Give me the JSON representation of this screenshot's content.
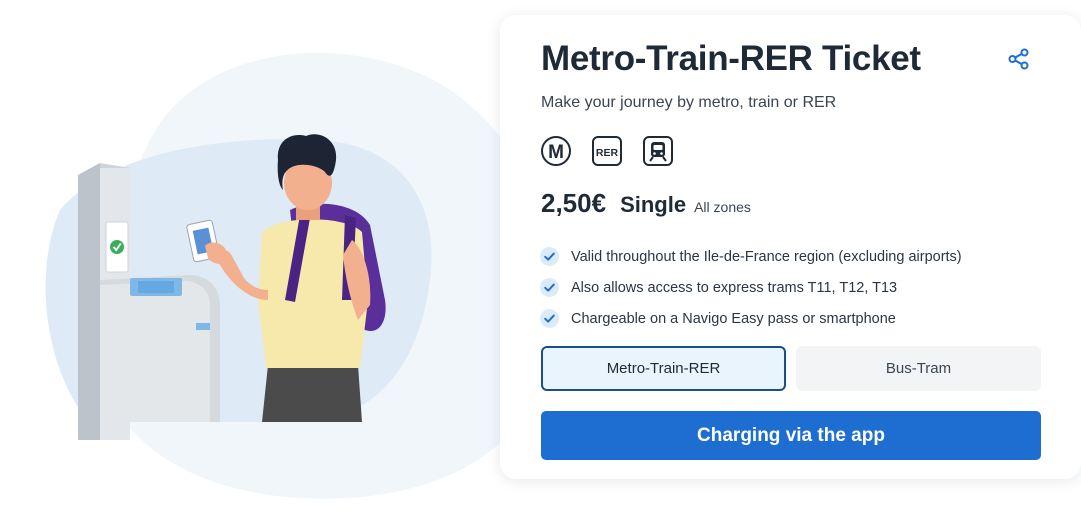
{
  "ticket": {
    "title": "Metro-Train-RER Ticket",
    "subtitle": "Make your journey by metro, train or RER",
    "price": "2,50€",
    "type": "Single",
    "zones": "All zones"
  },
  "transport_modes": [
    {
      "icon": "metro-icon",
      "label": "M"
    },
    {
      "icon": "rer-icon",
      "label": "RER"
    },
    {
      "icon": "train-icon",
      "label": ""
    }
  ],
  "features": [
    "Valid throughout the Ile-de-France region (excluding airports)",
    "Also allows access to express trams T11, T12, T13",
    "Chargeable on a Navigo Easy pass or smartphone"
  ],
  "tabs": [
    {
      "label": "Metro-Train-RER",
      "active": true
    },
    {
      "label": "Bus-Tram",
      "active": false
    }
  ],
  "cta": {
    "label": "Charging via the app"
  },
  "colors": {
    "accent": "#1e6ed2",
    "active_tab_border": "#1b4f86",
    "text": "#1f2a37"
  }
}
